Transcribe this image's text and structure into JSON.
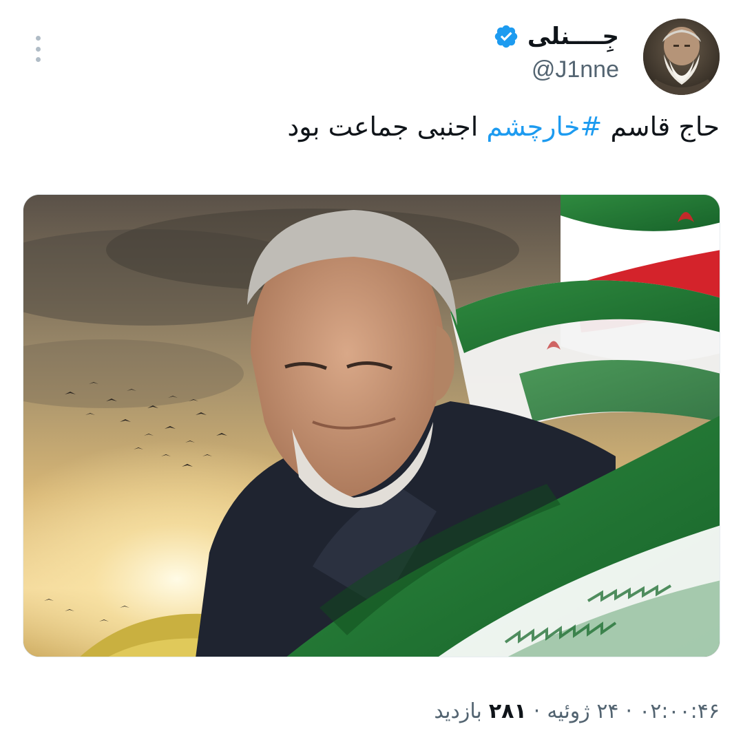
{
  "author": {
    "display_name": "جِــــنلی",
    "handle": "@J1nne",
    "verified": true,
    "verified_color": "#1d9bf0"
  },
  "tweet": {
    "text_before": "حاج قاسم ",
    "hashtag": "#خارچشم",
    "text_after": " اجنبی جماعت بود",
    "hashtag_color": "#1d9bf0"
  },
  "meta": {
    "time": "۰۲:۰۰:۴۶",
    "separator": "·",
    "date": "۲۴ ژوئیه",
    "views_count": "۲۸۱",
    "views_label": "بازدید"
  },
  "icons": {
    "more": "more-vertical-icon",
    "verified": "verified-badge-icon"
  }
}
